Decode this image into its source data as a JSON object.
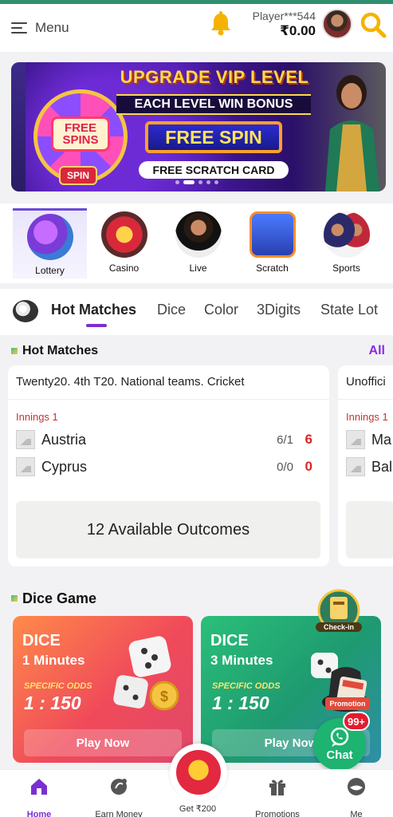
{
  "header": {
    "menu_label": "Menu",
    "player_name": "Player***544",
    "balance": "₹0.00"
  },
  "banner": {
    "title": "UPGRADE VIP LEVEL",
    "ribbon": "EACH LEVEL WIN BONUS",
    "free_spin": "FREE SPIN",
    "scratch": "FREE SCRATCH CARD",
    "wheel_text": "FREE SPINS",
    "spin_badge": "SPIN",
    "active_slide": 1,
    "slides": 5
  },
  "categories": [
    {
      "label": "Lottery",
      "icon": "lottery-balls-icon",
      "active": true
    },
    {
      "label": "Casino",
      "icon": "casino-slot-icon",
      "active": false
    },
    {
      "label": "Live",
      "icon": "live-dealer-icon",
      "active": false
    },
    {
      "label": "Scratch",
      "icon": "scratch-card-icon",
      "active": false
    },
    {
      "label": "Sports",
      "icon": "sports-players-icon",
      "active": false
    }
  ],
  "tabs": [
    "Hot Matches",
    "Dice",
    "Color",
    "3Digits",
    "State Lot"
  ],
  "hot_matches": {
    "title": "Hot Matches",
    "all_label": "All",
    "cards": [
      {
        "title": "Twenty20. 4th T20. National teams. Cricket",
        "innings": "Innings 1",
        "teams": [
          {
            "name": "Austria",
            "score": "6/1",
            "points": "6"
          },
          {
            "name": "Cyprus",
            "score": "0/0",
            "points": "0"
          }
        ],
        "outcomes": "12 Available Outcomes"
      },
      {
        "title": "Unoffici",
        "innings": "Innings 1",
        "teams": [
          {
            "name": "Ma",
            "score": "",
            "points": ""
          },
          {
            "name": "Bal",
            "score": "",
            "points": ""
          }
        ],
        "outcomes": ""
      }
    ]
  },
  "dice": {
    "title": "Dice Game",
    "cards": [
      {
        "title": "DICE",
        "sub": "1 Minutes",
        "odds_label": "SPECIFIC ODDS",
        "odds": "1 : 150",
        "play": "Play Now"
      },
      {
        "title": "DICE",
        "sub": "3 Minutes",
        "odds_label": "SPECIFIC ODDS",
        "odds": "1 : 150",
        "play": "Play Now",
        "promo": "Promotion"
      }
    ],
    "checkin_label": "Check-in"
  },
  "chat": {
    "label": "Chat",
    "badge": "99+"
  },
  "bottom_nav": [
    {
      "label": "Home",
      "active": true
    },
    {
      "label": "Earn Money",
      "active": false
    },
    {
      "label": "Get ₹200",
      "active": false
    },
    {
      "label": "Promotions",
      "active": false
    },
    {
      "label": "Me",
      "active": false
    }
  ],
  "colors": {
    "accent": "#7b2fd0",
    "chat_green": "#1db370",
    "score_red": "#e02424"
  }
}
